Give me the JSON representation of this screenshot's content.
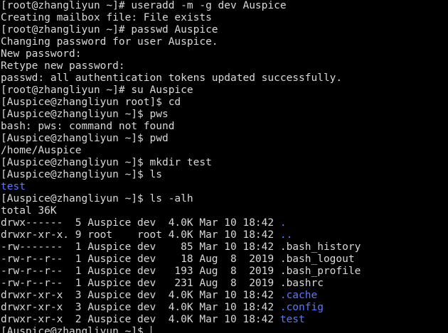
{
  "colors": {
    "background": "#000000",
    "text": "#d9d9d9",
    "directory": "#5b78ff"
  },
  "terminal": {
    "lines": [
      {
        "segments": [
          {
            "text": "[root@zhangliyun ~]# useradd -m -g dev Auspice",
            "kind": "text"
          }
        ]
      },
      {
        "segments": [
          {
            "text": "Creating mailbox file: File exists",
            "kind": "text"
          }
        ]
      },
      {
        "segments": [
          {
            "text": "[root@zhangliyun ~]# passwd Auspice",
            "kind": "text"
          }
        ]
      },
      {
        "segments": [
          {
            "text": "Changing password for user Auspice.",
            "kind": "text"
          }
        ]
      },
      {
        "segments": [
          {
            "text": "New password:",
            "kind": "text"
          }
        ]
      },
      {
        "segments": [
          {
            "text": "Retype new password:",
            "kind": "text"
          }
        ]
      },
      {
        "segments": [
          {
            "text": "passwd: all authentication tokens updated successfully.",
            "kind": "text"
          }
        ]
      },
      {
        "segments": [
          {
            "text": "[root@zhangliyun ~]# su Auspice",
            "kind": "text"
          }
        ]
      },
      {
        "segments": [
          {
            "text": "[Auspice@zhangliyun root]$ cd",
            "kind": "text"
          }
        ]
      },
      {
        "segments": [
          {
            "text": "[Auspice@zhangliyun ~]$ pws",
            "kind": "text"
          }
        ]
      },
      {
        "segments": [
          {
            "text": "bash: pws: command not found",
            "kind": "text"
          }
        ]
      },
      {
        "segments": [
          {
            "text": "[Auspice@zhangliyun ~]$ pwd",
            "kind": "text"
          }
        ]
      },
      {
        "segments": [
          {
            "text": "/home/Auspice",
            "kind": "text"
          }
        ]
      },
      {
        "segments": [
          {
            "text": "[Auspice@zhangliyun ~]$ mkdir test",
            "kind": "text"
          }
        ]
      },
      {
        "segments": [
          {
            "text": "[Auspice@zhangliyun ~]$ ls",
            "kind": "text"
          }
        ]
      },
      {
        "segments": [
          {
            "text": "test",
            "kind": "dir"
          }
        ]
      },
      {
        "segments": [
          {
            "text": "[Auspice@zhangliyun ~]$ ls -alh",
            "kind": "text"
          }
        ]
      },
      {
        "segments": [
          {
            "text": "total 36K",
            "kind": "text"
          }
        ]
      },
      {
        "segments": [
          {
            "text": "drwx------  5 Auspice dev  4.0K Mar 10 18:42 ",
            "kind": "text"
          },
          {
            "text": ".",
            "kind": "dir"
          }
        ]
      },
      {
        "segments": [
          {
            "text": "drwxr-xr-x. 9 root    root 4.0K Mar 10 18:42 ",
            "kind": "text"
          },
          {
            "text": "..",
            "kind": "dir"
          }
        ]
      },
      {
        "segments": [
          {
            "text": "-rw-------  1 Auspice dev    85 Mar 10 18:42 .bash_history",
            "kind": "text"
          }
        ]
      },
      {
        "segments": [
          {
            "text": "-rw-r--r--  1 Auspice dev    18 Aug  8  2019 .bash_logout",
            "kind": "text"
          }
        ]
      },
      {
        "segments": [
          {
            "text": "-rw-r--r--  1 Auspice dev   193 Aug  8  2019 .bash_profile",
            "kind": "text"
          }
        ]
      },
      {
        "segments": [
          {
            "text": "-rw-r--r--  1 Auspice dev   231 Aug  8  2019 .bashrc",
            "kind": "text"
          }
        ]
      },
      {
        "segments": [
          {
            "text": "drwxr-xr-x  3 Auspice dev  4.0K Mar 10 18:42 ",
            "kind": "text"
          },
          {
            "text": ".cache",
            "kind": "dir"
          }
        ]
      },
      {
        "segments": [
          {
            "text": "drwxr-xr-x  3 Auspice dev  4.0K Mar 10 18:42 ",
            "kind": "text"
          },
          {
            "text": ".config",
            "kind": "dir"
          }
        ]
      },
      {
        "segments": [
          {
            "text": "drwxr-xr-x  2 Auspice dev  4.0K Mar 10 18:42 ",
            "kind": "text"
          },
          {
            "text": "test",
            "kind": "dir"
          }
        ]
      },
      {
        "segments": [
          {
            "text": "[Auspice@zhangliyun ~]$ ",
            "kind": "text"
          }
        ],
        "cursor": true
      }
    ]
  }
}
